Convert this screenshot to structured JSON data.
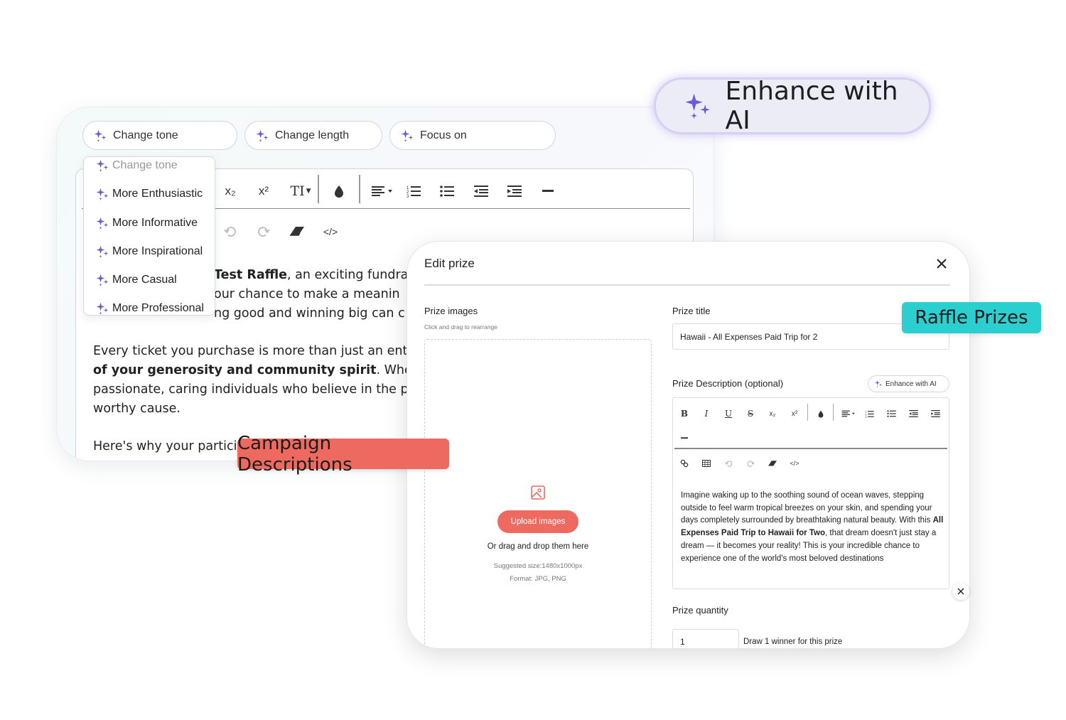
{
  "colors": {
    "sparkle": "#6b5bd6",
    "campaign_label_bg": "#ee6a60",
    "raffle_label_bg": "#2ccfd0",
    "upload_button_bg": "#ee6a60",
    "enhance_badge_border": "#d6d0f3"
  },
  "toolbar_pills": [
    {
      "label": "Change tone",
      "icon": "sparkle-icon"
    },
    {
      "label": "Change length",
      "icon": "sparkle-icon"
    },
    {
      "label": "Focus on",
      "icon": "sparkle-icon"
    }
  ],
  "tone_dropdown": {
    "header": "Change tone",
    "options": [
      "More Enthusiastic",
      "More Informative",
      "More Inspirational",
      "More Casual",
      "More Professional"
    ]
  },
  "editor": {
    "toolbar_icons": [
      "subscript-icon",
      "superscript-icon",
      "text-size-icon",
      "color-drop-icon",
      "align-icon",
      "ordered-list-icon",
      "bullet-list-icon",
      "outdent-icon",
      "indent-icon",
      "horizontal-rule-icon",
      "undo-icon",
      "redo-icon",
      "eraser-icon",
      "code-icon"
    ],
    "subscript_label": "x₂",
    "superscript_label": "x²",
    "text_size_label": "TI",
    "code_label": "</>",
    "p1_line1_bold": "Test Raffle",
    "p1_line1_rest": ", an exciting fundrai",
    "p1_line2": "our chance to make a meanin",
    "p1_line3": "ng good and winning big can c",
    "p2_line1": "Every ticket you purchase is more than just an ent",
    "p2_line2_bold": "of your generosity and community spirit",
    "p2_line2_rest": ". When you",
    "p2_line3": "passionate, caring individuals who believe in the p",
    "p2_line4": "worthy cause.",
    "p3_line1": "Here's why your partici"
  },
  "labels": {
    "campaign": "Campaign Descriptions",
    "raffle": "Raffle Prizes",
    "enhance_badge": "Enhance with AI"
  },
  "modal": {
    "title": "Edit prize",
    "prize_images_label": "Prize images",
    "prize_images_hint": "Click and drag to rearrange",
    "upload_button": "Upload images",
    "drag_text": "Or drag and drop them here",
    "suggested_size": "Suggested size:1480x1000px",
    "format": "Format: JPG, PNG",
    "prize_title_label": "Prize title",
    "prize_title_value": "Hawaii - All Expenses Paid Trip for 2",
    "description_label": "Prize Description (optional)",
    "enhance_button": "Enhance with AI",
    "rte_bold": "B",
    "rte_italic": "I",
    "rte_underline": "U",
    "rte_strike": "S",
    "rte_sub": "x₂",
    "rte_sup": "x²",
    "rte_code": "</>",
    "desc_part1": "Imagine waking up to the soothing sound of ocean waves, stepping outside to feel warm tropical breezes on your skin, and spending your days completely surrounded by breathtaking natural beauty. With this ",
    "desc_bold": "All Expenses Paid Trip to Hawaii for Two",
    "desc_part2": ", that dream doesn't just stay a dream — it becomes your reality! This is your incredible chance to experience one of the world's most beloved destinations",
    "quantity_label": "Prize quantity",
    "quantity_value": "1",
    "quantity_hint": "Draw 1 winner for this prize"
  }
}
